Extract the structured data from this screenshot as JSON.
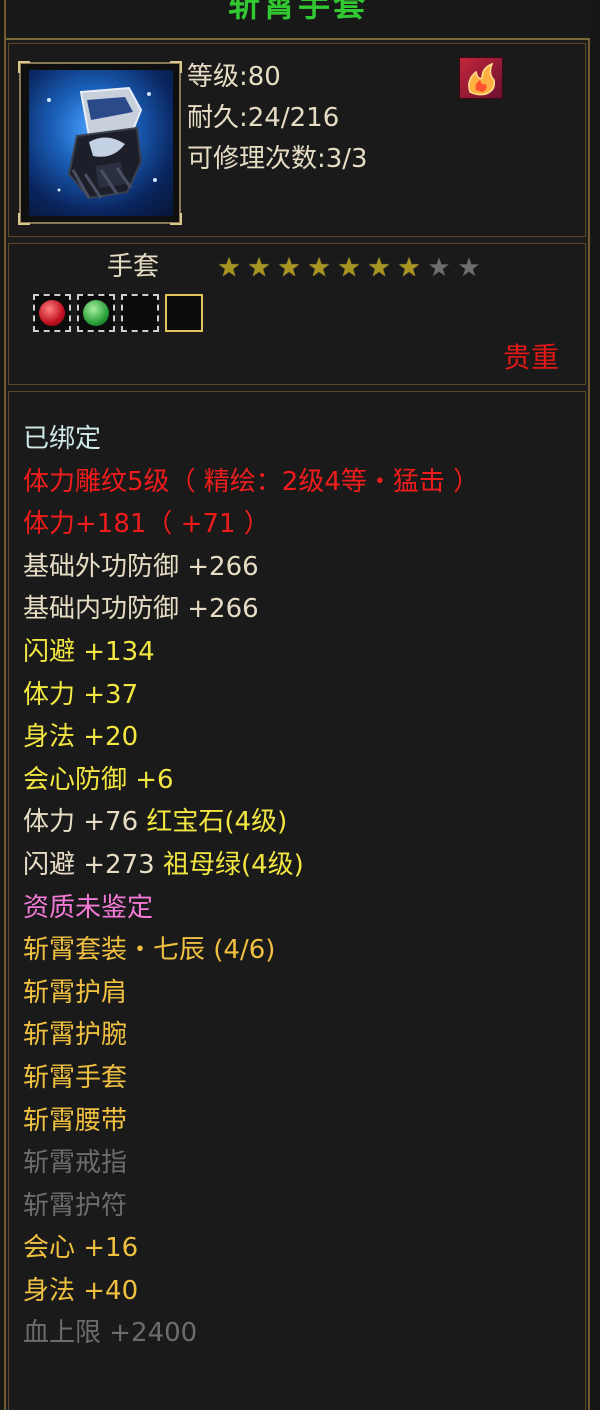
{
  "title": "斩霄手套",
  "info": {
    "level": "等级:80",
    "durability": "耐久:24/216",
    "repair": "可修理次数:3/3"
  },
  "item_type": "手套",
  "stars": {
    "filled": 7,
    "total": 9
  },
  "rarity": "贵重",
  "gems": [
    {
      "type": "red",
      "slot": "filled"
    },
    {
      "type": "green",
      "slot": "filled"
    },
    {
      "type": "empty",
      "slot": "empty"
    },
    {
      "type": "empty",
      "slot": "gold"
    }
  ],
  "attributes": [
    {
      "text": "已绑定",
      "color": "white"
    },
    {
      "text": "体力雕纹5级（ 精绘：2级4等・猛击 ）",
      "color": "red"
    },
    {
      "text": "体力+181（ +71 ）",
      "color": "red"
    },
    {
      "text": "基础外功防御 +266",
      "color": "base"
    },
    {
      "text": "基础内功防御 +266",
      "color": "base"
    },
    {
      "text": "闪避 +134",
      "color": "yellow"
    },
    {
      "text": "体力 +37",
      "color": "yellow"
    },
    {
      "text": "身法 +20",
      "color": "yellow"
    },
    {
      "text": "会心防御 +6",
      "color": "yellow"
    },
    {
      "text": "体力 +76 ",
      "suffix": "红宝石(4级)",
      "color": "base",
      "suffix_color": "yellow"
    },
    {
      "text": "闪避 +273 ",
      "suffix": "祖母绿(4级)",
      "color": "base",
      "suffix_color": "yellow"
    },
    {
      "text": "资质未鉴定",
      "color": "pink"
    },
    {
      "text": "斩霄套装・七辰 (4/6)",
      "color": "orange"
    },
    {
      "text": "斩霄护肩",
      "color": "orange"
    },
    {
      "text": "斩霄护腕",
      "color": "orange"
    },
    {
      "text": "斩霄手套",
      "color": "orange"
    },
    {
      "text": "斩霄腰带",
      "color": "orange"
    },
    {
      "text": "斩霄戒指",
      "color": "gray"
    },
    {
      "text": "斩霄护符",
      "color": "gray"
    },
    {
      "text": "会心 +16",
      "color": "orange"
    },
    {
      "text": "身法 +40",
      "color": "orange"
    },
    {
      "text": "血上限 +2400",
      "color": "gray"
    }
  ]
}
